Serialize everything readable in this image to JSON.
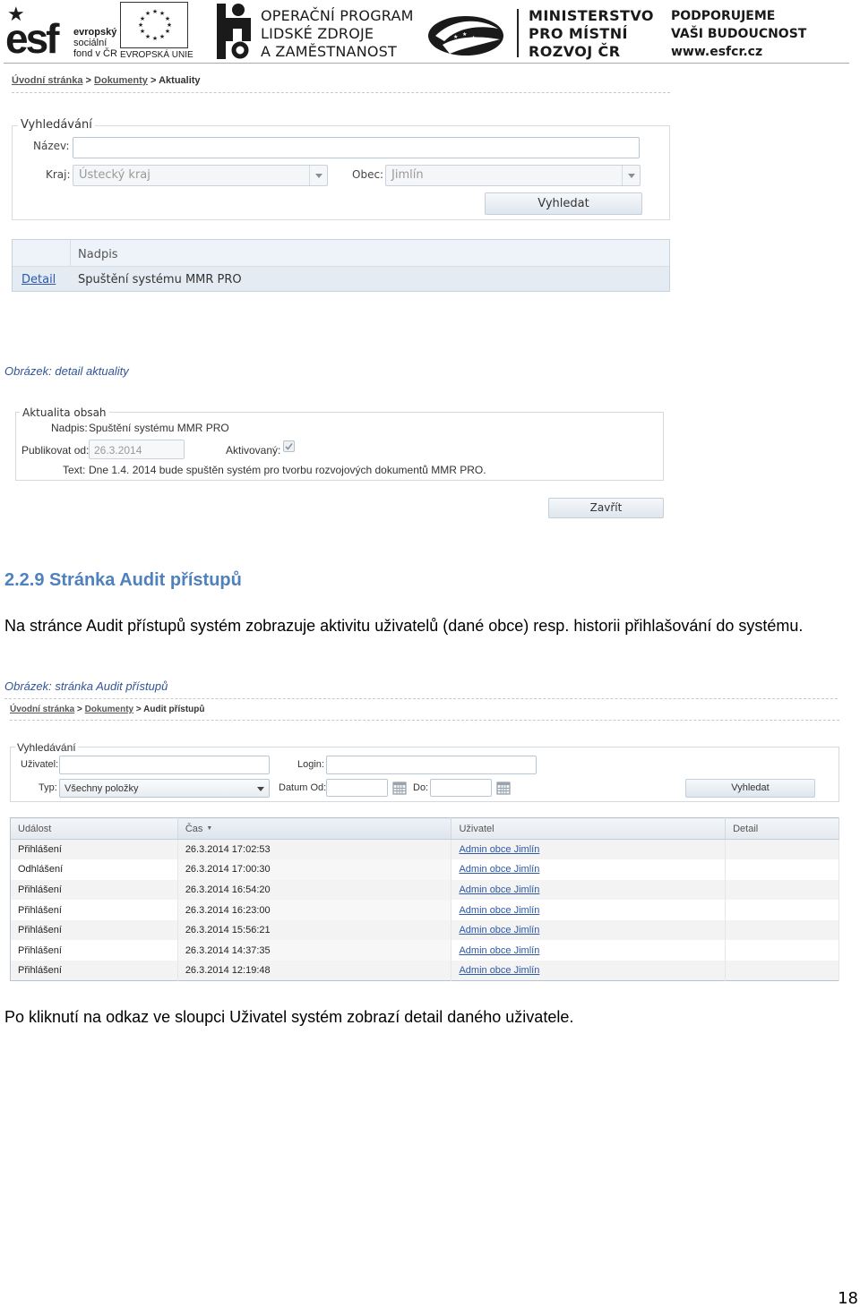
{
  "header": {
    "esf_lines": [
      "evropský",
      "sociální",
      "fond v ČR"
    ],
    "eu_label": "EVROPSKÁ UNIE",
    "op_lines": [
      "OPERAČNÍ PROGRAM",
      "LIDSKÉ ZDROJE",
      "A ZAMĚSTNANOST"
    ],
    "mmr_lines": [
      "MINISTERSTVO",
      "PRO MÍSTNÍ",
      "ROZVOJ ČR"
    ],
    "support_lines": [
      "PODPORUJEME",
      "VAŠI BUDOUCNOST",
      "www.esfcr.cz"
    ]
  },
  "shot1": {
    "breadcrumb": {
      "home": "Úvodní stránka",
      "docs": "Dokumenty",
      "current": "Aktuality",
      "sep": ">"
    },
    "search": {
      "legend": "Vyhledávání",
      "name_label": "Název:",
      "name_value": "",
      "region_label": "Kraj:",
      "region_value": "Ústecký kraj",
      "town_label": "Obec:",
      "town_value": "Jimlín",
      "search_button": "Vyhledat"
    },
    "grid": {
      "header": "Nadpis",
      "row_link": "Detail",
      "row_title": "Spuštění systému MMR PRO"
    }
  },
  "caption1": "Obrázek: detail aktuality",
  "detail": {
    "legend": "Aktualita obsah",
    "title_label": "Nadpis:",
    "title_value": "Spuštění systému MMR PRO",
    "publish_label": "Publikovat od:",
    "publish_value": "26.3.2014",
    "active_label": "Aktivovaný:",
    "text_label": "Text:",
    "text_value": "Dne 1.4. 2014 bude spuštěn systém pro tvorbu rozvojových dokumentů MMR PRO.",
    "close_button": "Zavřít"
  },
  "section": {
    "heading": "2.2.9 Stránka Audit přístupů",
    "paragraph": "Na stránce Audit přístupů systém zobrazuje aktivitu uživatelů (dané obce) resp. historii přihlašování do systému."
  },
  "caption2": "Obrázek: stránka Audit přístupů",
  "shot2": {
    "breadcrumb": {
      "home": "Úvodní stránka",
      "docs": "Dokumenty",
      "current": "Audit přístupů",
      "sep": ">"
    },
    "search": {
      "legend": "Vyhledávání",
      "user_label": "Uživatel:",
      "user_value": "",
      "login_label": "Login:",
      "login_value": "",
      "type_label": "Typ:",
      "type_value": "Všechny položky",
      "date_from_label": "Datum Od:",
      "date_to_label": "Do:",
      "search_button": "Vyhledat"
    },
    "table": {
      "columns": [
        "Událost",
        "Čas",
        "Uživatel",
        "Detail"
      ],
      "rows": [
        {
          "event": "Přihlášení",
          "time": "26.3.2014 17:02:53",
          "user": "Admin obce Jimlín",
          "detail": ""
        },
        {
          "event": "Odhlášení",
          "time": "26.3.2014 17:00:30",
          "user": "Admin obce Jimlín",
          "detail": ""
        },
        {
          "event": "Přihlášení",
          "time": "26.3.2014 16:54:20",
          "user": "Admin obce Jimlín",
          "detail": ""
        },
        {
          "event": "Přihlášení",
          "time": "26.3.2014 16:23:00",
          "user": "Admin obce Jimlín",
          "detail": ""
        },
        {
          "event": "Přihlášení",
          "time": "26.3.2014 15:56:21",
          "user": "Admin obce Jimlín",
          "detail": ""
        },
        {
          "event": "Přihlášení",
          "time": "26.3.2014 14:37:35",
          "user": "Admin obce Jimlín",
          "detail": ""
        },
        {
          "event": "Přihlášení",
          "time": "26.3.2014 12:19:48",
          "user": "Admin obce Jimlín",
          "detail": ""
        }
      ]
    }
  },
  "closing_paragraph": "Po kliknutí na odkaz ve sloupci Uživatel systém zobrazí detail daného uživatele.",
  "page_number": "18"
}
